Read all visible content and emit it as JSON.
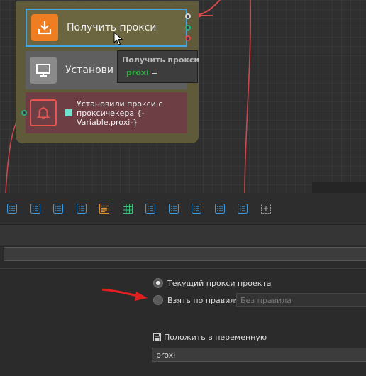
{
  "canvas": {
    "actions": {
      "get_proxy": {
        "label": "Получить прокси",
        "icon": "download-tray-icon",
        "color": "#ef7e22"
      },
      "set_proxy": {
        "label": "Установи",
        "icon": "monitor-icon",
        "color": "#8a8a8a"
      },
      "notify": {
        "label": "Установили прокси с проксичекера {-Variable.proxi-}",
        "icon": "bell-icon",
        "color": "#e8544f"
      }
    },
    "tooltip": {
      "title": "Получить прокси",
      "var_name": "proxi",
      "equals": "="
    },
    "group_color": "#5e5a3a",
    "selection_color": "#45a4e2"
  },
  "toolbar": {
    "buttons": [
      "list-icon",
      "list-icon",
      "list-icon",
      "list-icon",
      "form-icon",
      "table-icon",
      "list-icon",
      "list-icon",
      "list-icon",
      "list-icon",
      "list-icon",
      "add-placeholder-icon"
    ]
  },
  "properties": {
    "source_options": [
      {
        "label": "Текущий прокси проекта",
        "selected": true
      },
      {
        "label": "Взять по правилу:",
        "selected": false
      }
    ],
    "rule_placeholder": "Без правила",
    "save_label": "Положить в переменную",
    "variable_value": "proxi"
  },
  "colors": {
    "accent": "#45a4e2",
    "annotation_arrow": "#e02020",
    "var_green": "#28b33c"
  }
}
